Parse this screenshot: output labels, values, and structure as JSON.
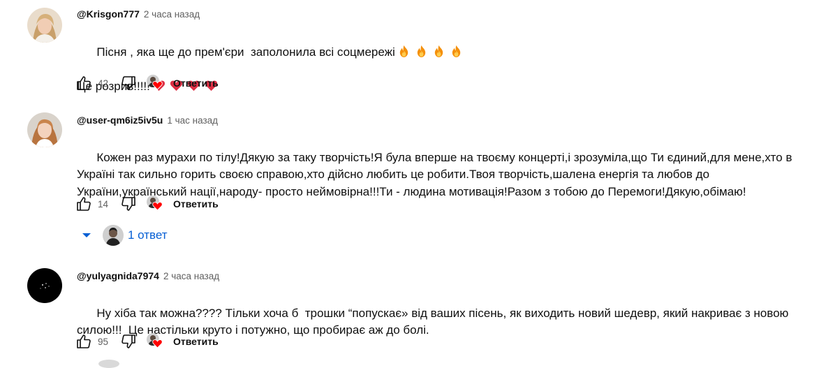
{
  "comments": [
    {
      "author": "@Krisgon777",
      "time": "2 часа назад",
      "line1": "Пісня , яка ще до прем'єри  заполонила всі соцмережі",
      "line2": "Це розрив!!!!!",
      "likes": "42",
      "reply_label": "Ответить",
      "icons": [
        "fire-emoji",
        "heart-emoji"
      ]
    },
    {
      "author": "@user-qm6iz5iv5u",
      "time": "1 час назад",
      "line1": "Кожен раз мурахи по тілу!Дякую за таку творчість!Я була вперше на твоєму концерті,і зрозуміла,що Ти єдиний,для мене,хто в",
      "line2": "Україні так сильно горить своєю справою,хто дійсно любить це робити.Твоя творчість,шалена енергія та любов до",
      "line3": "України,український нації,народу- просто неймовірна!!!Ти - людина мотивація!Разом з тобою до Перемоги!Дякую,обімаю!",
      "likes": "14",
      "reply_label": "Ответить",
      "replies_label": "1 ответ"
    },
    {
      "author": "@yulyagnida7974",
      "time": "2 часа назад",
      "line1": "Ну хіба так можна???? Тільки хоча б  трошки “попускає» від ваших пісень, як виходить новий шедевр, який накриває з новою",
      "line2": "силою!!!  Це настільки круто і потужно, що пробирає аж до болі.",
      "likes": "95",
      "reply_label": "Ответить"
    }
  ],
  "colors": {
    "link_blue": "#065fd4",
    "meta_gray": "#606060",
    "text": "#0f0f0f",
    "heart_red": "#ff0000"
  }
}
